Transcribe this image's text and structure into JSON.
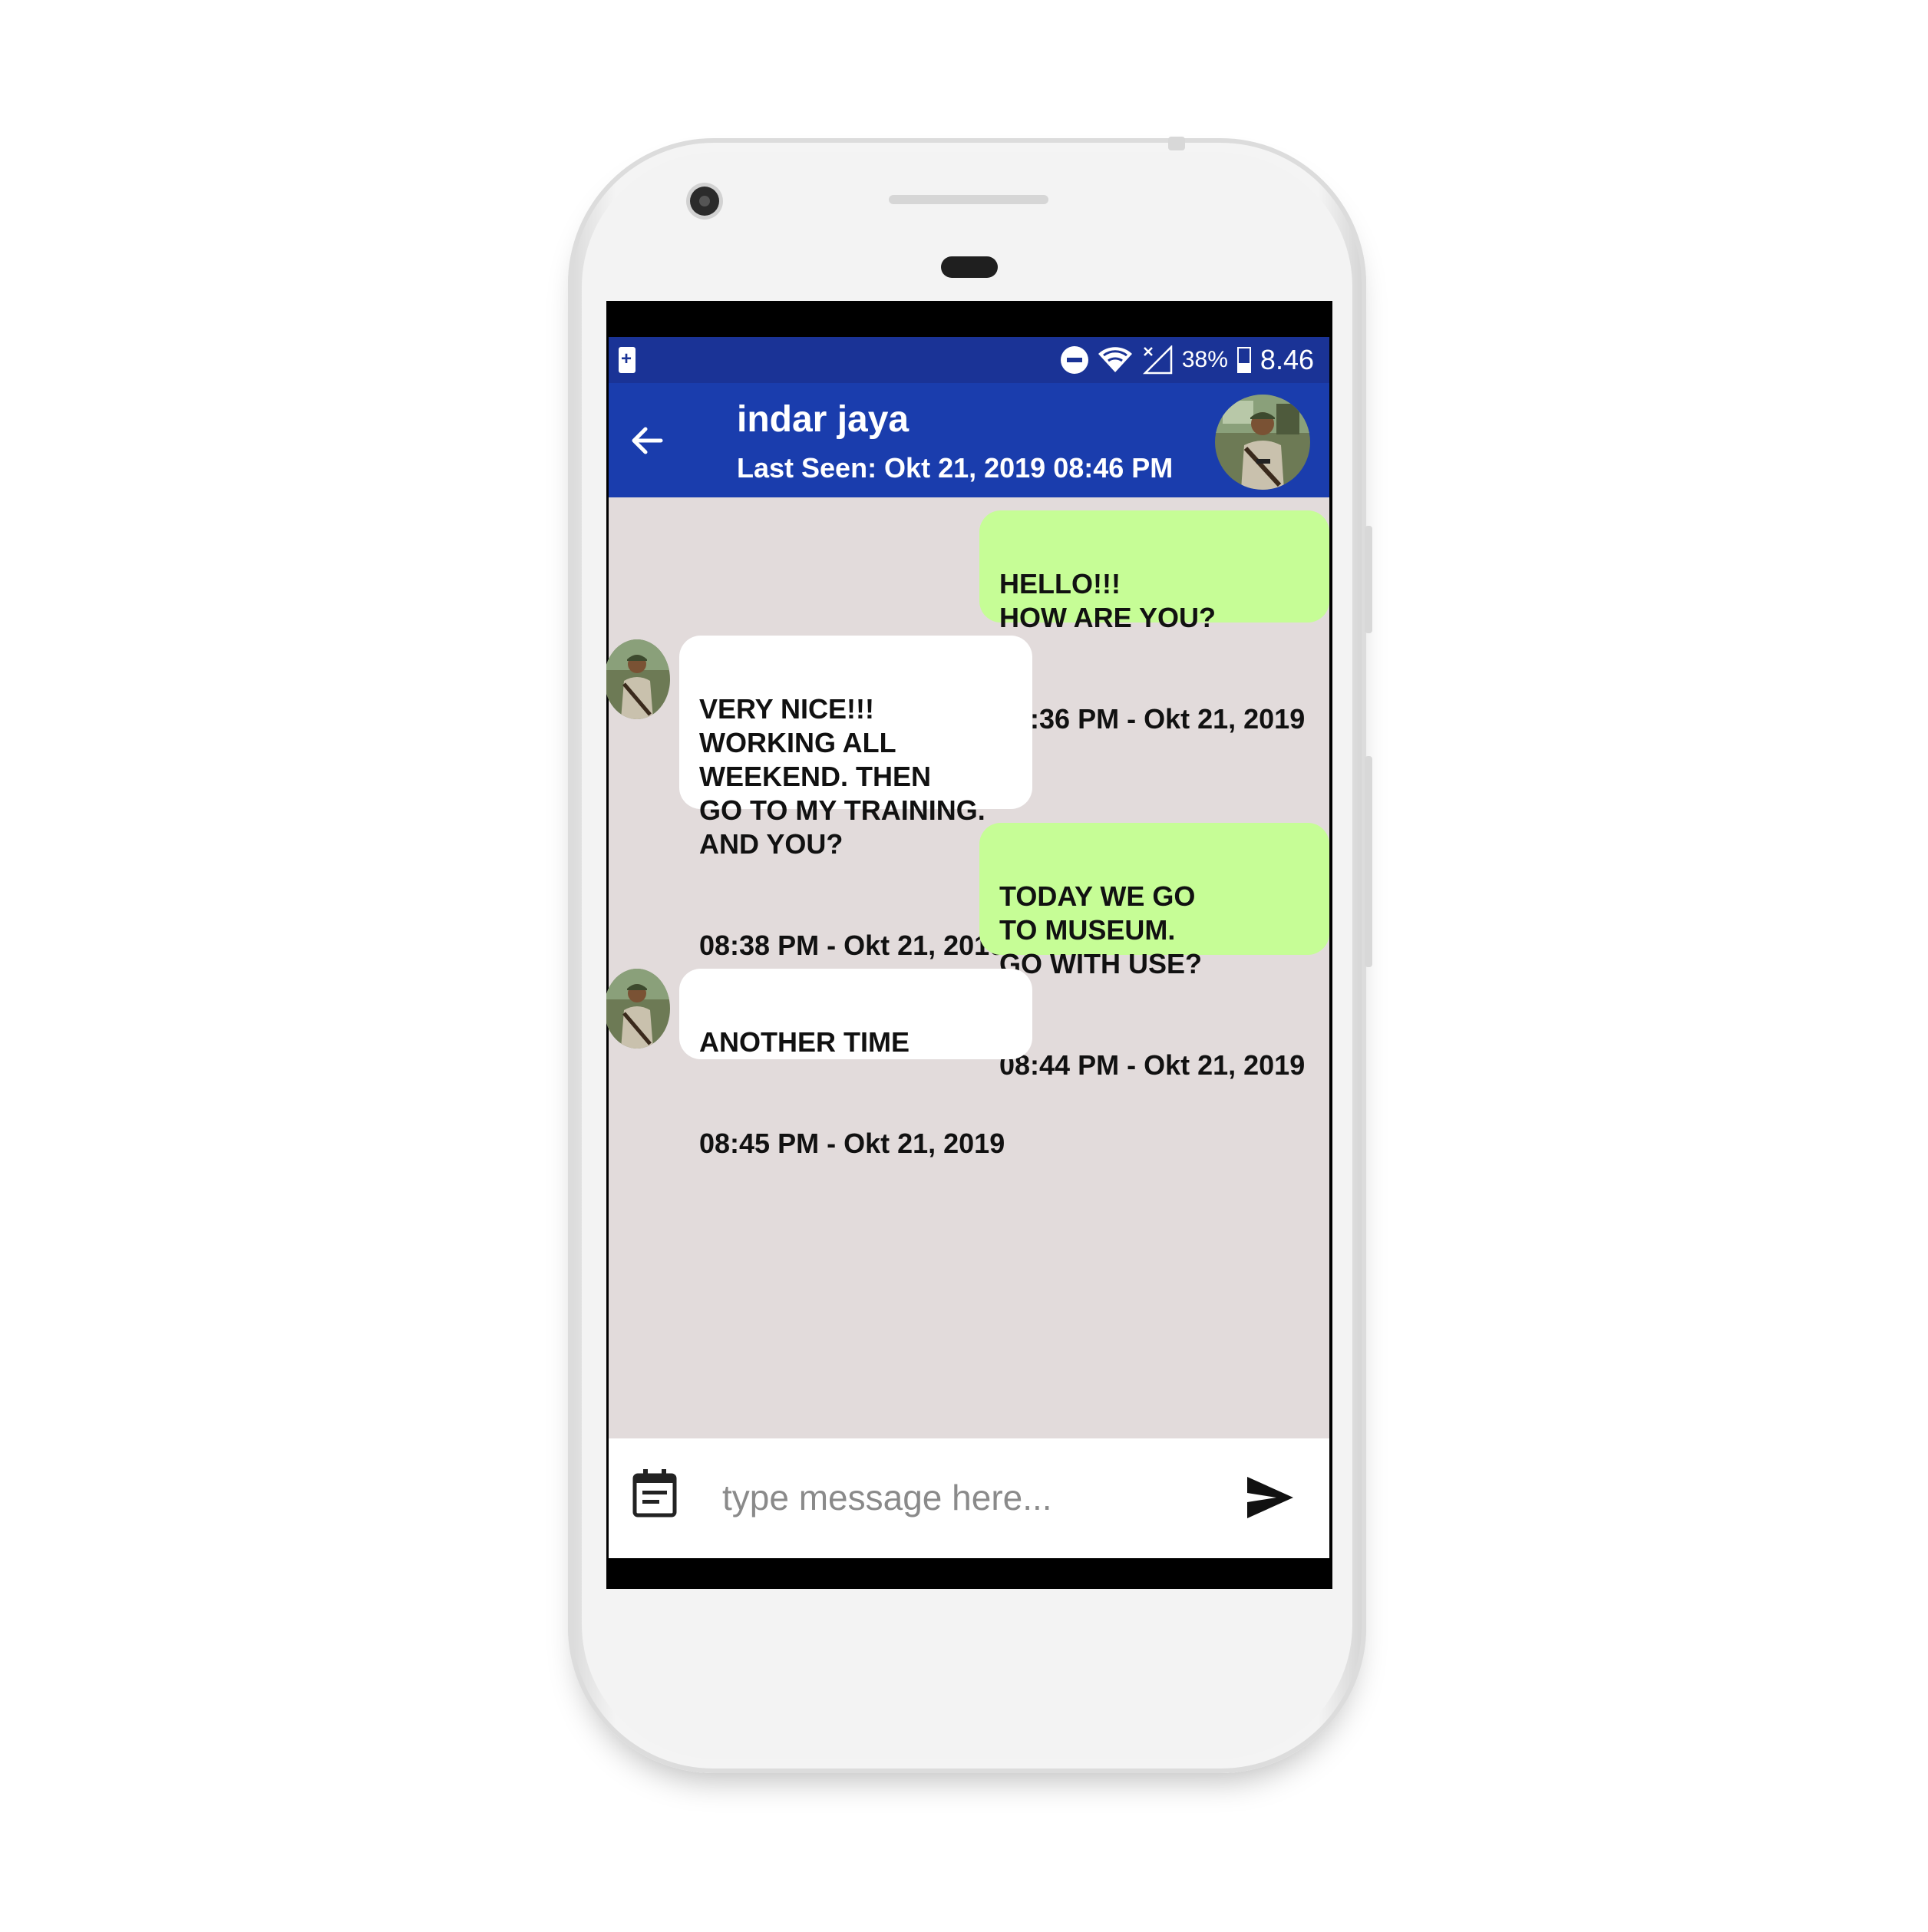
{
  "status_bar": {
    "battery_percent": "38%",
    "time": "8.46",
    "icons": [
      "battery-saver-icon",
      "do-not-disturb-icon",
      "wifi-icon",
      "signal-off-icon",
      "battery-icon"
    ]
  },
  "header": {
    "contact_name": "indar jaya",
    "last_seen": "Last Seen: Okt 21, 2019 08:46 PM",
    "back_icon": "arrow-back-icon",
    "avatar": "contact-avatar"
  },
  "messages": [
    {
      "direction": "outgoing",
      "text": "HELLO!!!\nHOW ARE YOU?",
      "time": "08:36 PM - Okt 21, 2019"
    },
    {
      "direction": "incoming",
      "text": "VERY NICE!!!\nWORKING ALL\nWEEKEND. THEN\nGO TO MY TRAINING.\nAND YOU?",
      "time": "08:38 PM - Okt 21, 2019"
    },
    {
      "direction": "outgoing",
      "text": "TODAY WE GO\nTO MUSEUM.\nGO WITH USE?",
      "time": "08:44 PM - Okt 21, 2019"
    },
    {
      "direction": "incoming",
      "text": "ANOTHER TIME",
      "time": "08:45 PM - Okt 21, 2019"
    }
  ],
  "composer": {
    "placeholder": "type message here...",
    "value": "",
    "attach_icon": "calendar-note-icon",
    "send_icon": "send-icon"
  },
  "colors": {
    "status_bar": "#1a3396",
    "app_bar": "#1a3dad",
    "chat_background": "#e2dbdb",
    "outgoing_bubble": "#c6fd96",
    "incoming_bubble": "#ffffff"
  }
}
